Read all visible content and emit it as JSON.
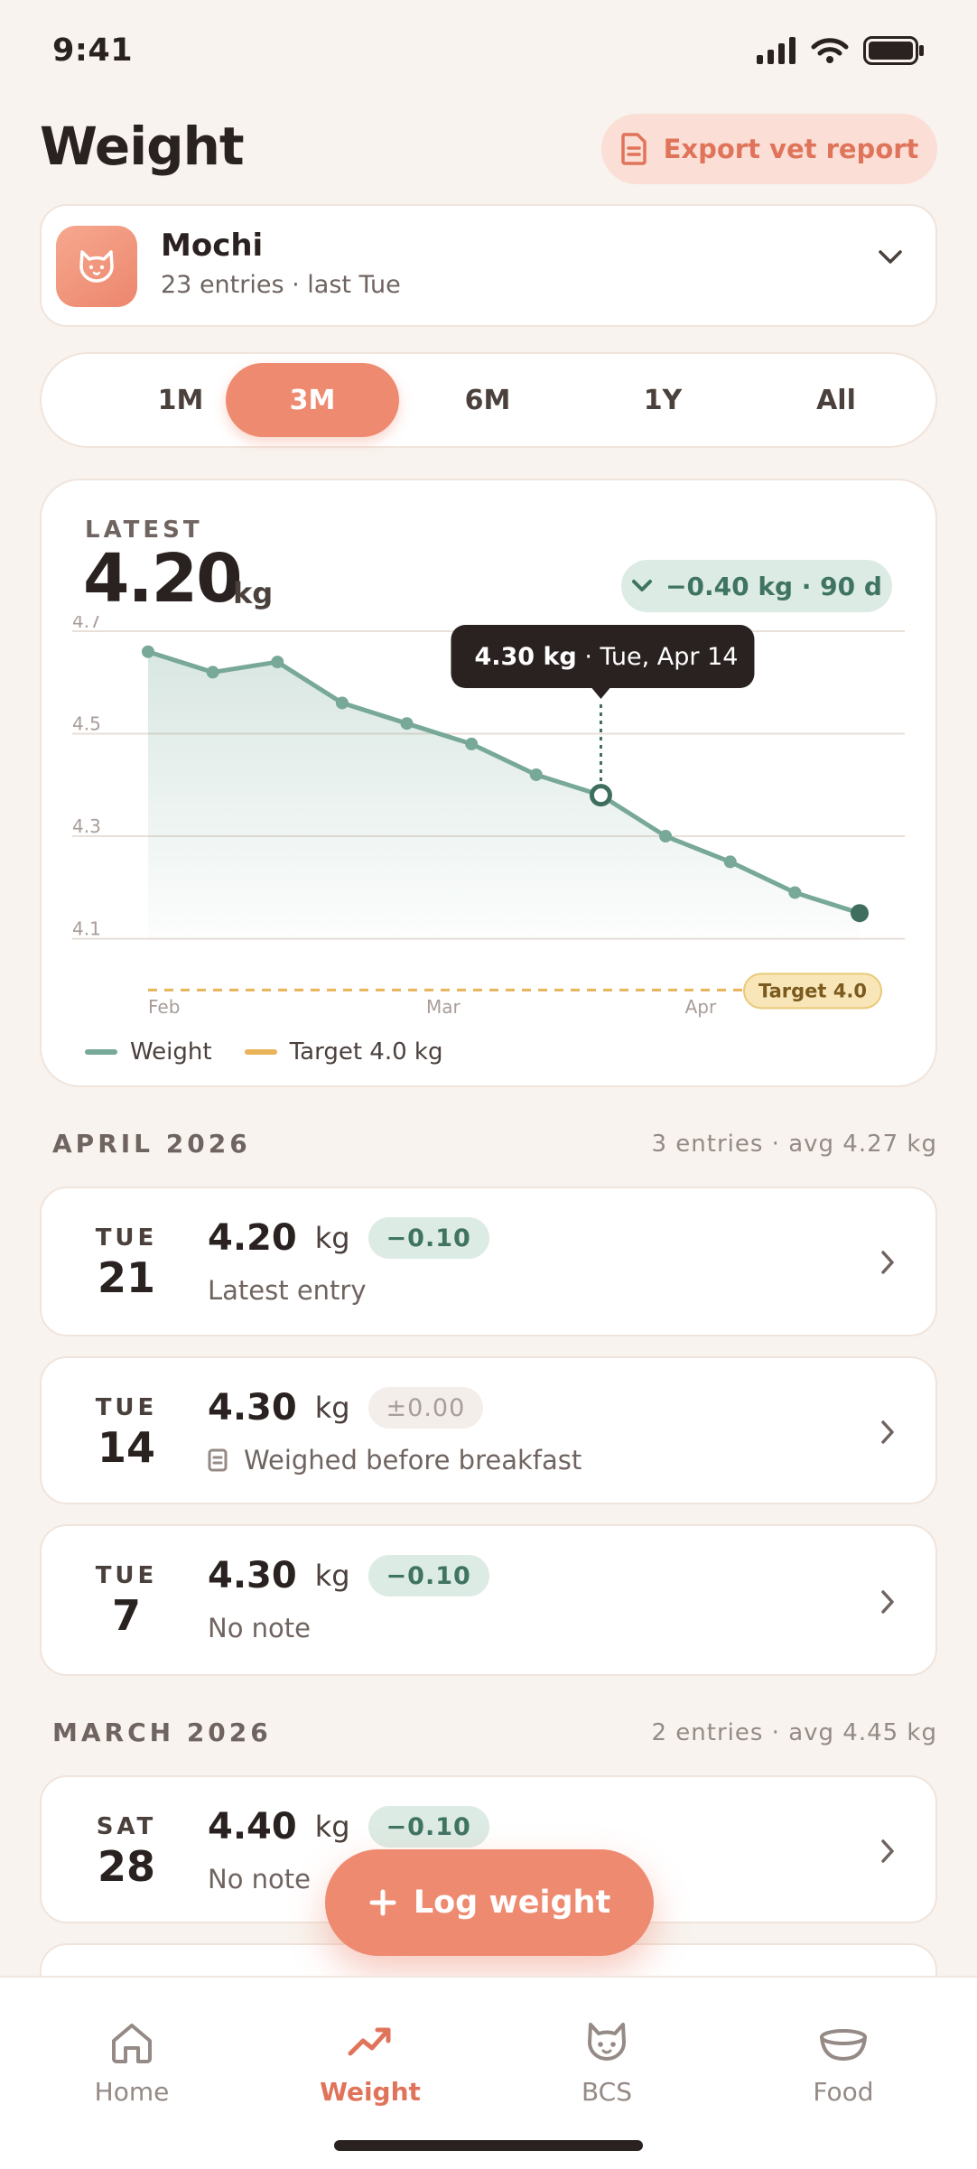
{
  "status_bar": {
    "time": "9:41"
  },
  "header": {
    "title": "Weight",
    "export_label": "Export vet report"
  },
  "pet": {
    "name": "Mochi",
    "meta": "23 entries · last Tue"
  },
  "range_tabs": [
    {
      "label": "1M",
      "active": false
    },
    {
      "label": "3M",
      "active": true
    },
    {
      "label": "6M",
      "active": false
    },
    {
      "label": "1Y",
      "active": false
    },
    {
      "label": "All",
      "active": false
    }
  ],
  "summary": {
    "latest_label": "LATEST",
    "latest_value": "4.20",
    "latest_unit": "kg",
    "delta": "−0.40 kg · 90 d"
  },
  "chart_data": {
    "type": "line",
    "series": [
      {
        "name": "Weight",
        "values": [
          4.66,
          4.62,
          4.64,
          4.56,
          4.52,
          4.48,
          4.42,
          4.38,
          4.3,
          4.25,
          4.19,
          4.15
        ]
      }
    ],
    "target": {
      "value": 4.0,
      "label": "Target 4.0"
    },
    "y_ticks": [
      "4.7",
      "4.5",
      "4.3",
      "4.1"
    ],
    "y_tick_values": [
      4.7,
      4.5,
      4.3,
      4.1
    ],
    "ylim": [
      3.99,
      4.73
    ],
    "x_ticks": [
      {
        "label": "Feb",
        "index": 0
      },
      {
        "label": "Mar",
        "index": 4.3
      },
      {
        "label": "Apr",
        "index": 8.3
      }
    ],
    "tooltip": {
      "index": 7,
      "value": "4.30 kg",
      "date": " · Tue, Apr 14"
    },
    "legend": [
      "Weight",
      "Target 4.0 kg"
    ],
    "colors": {
      "line": "#77a898",
      "target": "#e9b35a",
      "last_point": "#3f6e5e"
    }
  },
  "sections": [
    {
      "title": "APRIL 2026",
      "meta": "3 entries · avg 4.27 kg"
    },
    {
      "title": "MARCH 2026",
      "meta": "2 entries · avg 4.45 kg"
    }
  ],
  "entries": [
    {
      "dow": "TUE",
      "day": "21",
      "value": "4.20",
      "unit": "kg",
      "delta": "−0.10",
      "note": "Latest entry"
    },
    {
      "dow": "TUE",
      "day": "14",
      "value": "4.30",
      "unit": "kg",
      "delta": "±0.00",
      "note": "Weighed before breakfast"
    },
    {
      "dow": "TUE",
      "day": "7",
      "value": "4.30",
      "unit": "kg",
      "delta": "−0.10",
      "note": "No note"
    },
    {
      "dow": "SAT",
      "day": "28",
      "value": "4.40",
      "unit": "kg",
      "delta": "−0.10",
      "note": "No note"
    }
  ],
  "fab": {
    "label": "Log weight"
  },
  "nav": [
    {
      "label": "Home",
      "icon": "home-icon",
      "active": false
    },
    {
      "label": "Weight",
      "icon": "trend-icon",
      "active": true
    },
    {
      "label": "BCS",
      "icon": "cat-icon",
      "active": false
    },
    {
      "label": "Food",
      "icon": "bowl-icon",
      "active": false
    }
  ]
}
